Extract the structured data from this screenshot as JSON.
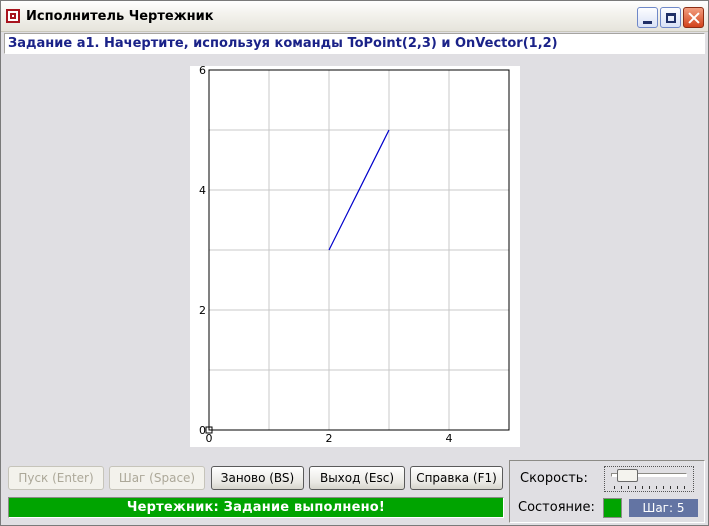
{
  "window": {
    "title": "Исполнитель Чертежник",
    "icon": "concentric-squares-icon"
  },
  "task": {
    "text": "Задание а1. Начертите, используя команды ToPoint(2,3) и OnVector(1,2)"
  },
  "chart_data": {
    "type": "line",
    "xlim": [
      0,
      5
    ],
    "ylim": [
      0,
      6
    ],
    "grid": true,
    "x_ticks": [
      "0",
      "2",
      "4"
    ],
    "x_tick_values": [
      0,
      2,
      4
    ],
    "y_ticks": [
      "0",
      "2",
      "4",
      "6"
    ],
    "y_tick_values": [
      0,
      2,
      4,
      6
    ],
    "series": [
      {
        "x": [
          2,
          3
        ],
        "y": [
          3,
          5
        ],
        "color": "#0000cc"
      }
    ],
    "pen_marker": {
      "x": 0,
      "y": 0
    }
  },
  "buttons": {
    "run": "Пуск (Enter)",
    "step": "Шаг (Space)",
    "restart": "Заново (BS)",
    "exit": "Выход (Esc)",
    "help": "Справка (F1)"
  },
  "status": {
    "text": "Чертежник: Задание выполнено!",
    "color": "#00a400"
  },
  "controls": {
    "speed_label": "Скорость:",
    "speed_level": 0.1,
    "state_label": "Состояние:",
    "state_color": "#00a400",
    "step_counter": "Шаг: 5"
  }
}
